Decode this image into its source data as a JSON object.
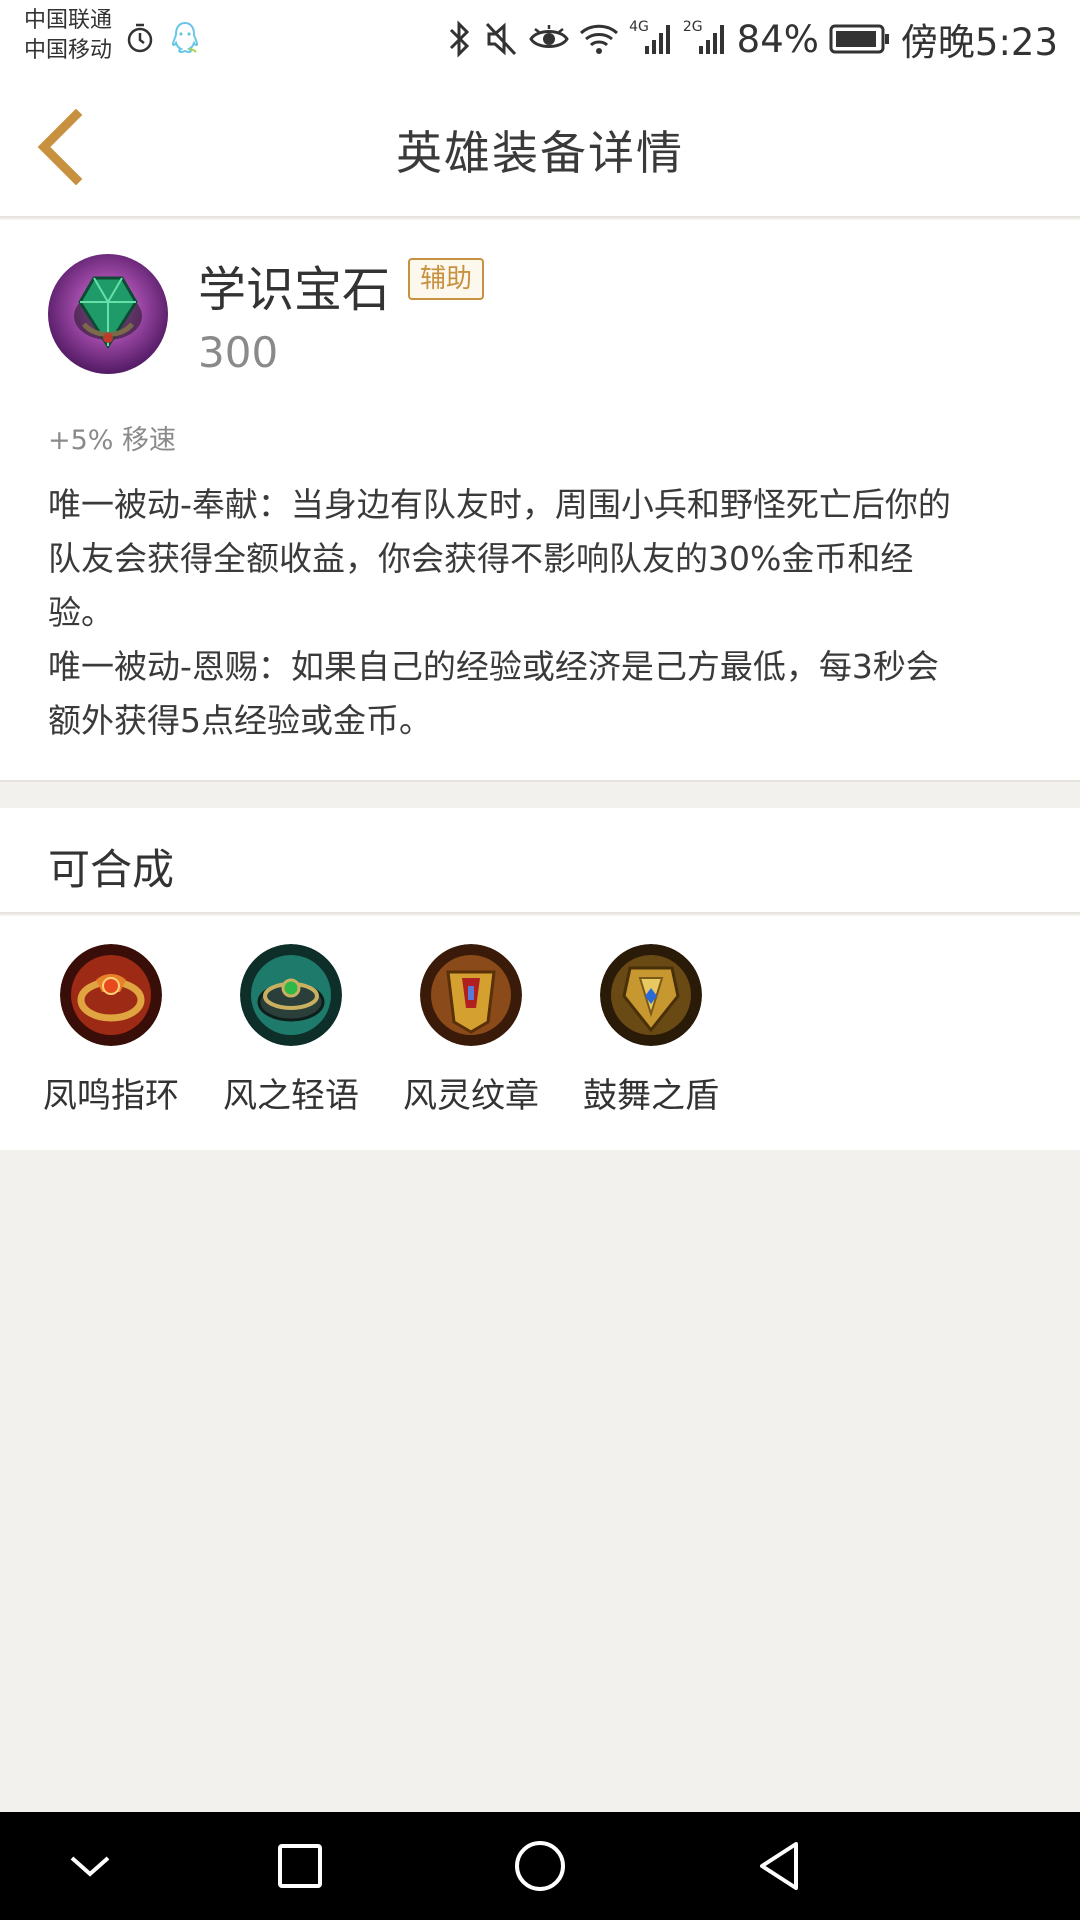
{
  "status_bar": {
    "carrier_1": "中国联通",
    "carrier_2": "中国移动",
    "battery_percent": "84%",
    "time": "傍晚5:23",
    "net_4g": "4G",
    "net_2g": "2G",
    "icons": [
      "alarm-icon",
      "qq-icon",
      "bluetooth-icon",
      "mute-icon",
      "eye-icon",
      "wifi-icon",
      "signal-icon",
      "battery-icon"
    ]
  },
  "header": {
    "title": "英雄装备详情",
    "back_icon": "chevron-left-icon",
    "accent_color": "#c7913f"
  },
  "item": {
    "name": "学识宝石",
    "tag": "辅助",
    "price": "300",
    "stat": "+5% 移速",
    "description_lines": [
      "唯一被动-奉献：当身边有队友时，周围小兵和野怪死亡后你的",
      "队友会获得全额收益，你会获得不影响队友的30%金币和经",
      "验。",
      "唯一被动-恩赐：如果自己的经验或经济是己方最低，每3秒会",
      "额外获得5点经验或金币。"
    ]
  },
  "combine_section": {
    "title": "可合成",
    "items": [
      {
        "label": "凤鸣指环",
        "icon": "phoenix-ring-icon"
      },
      {
        "label": "风之轻语",
        "icon": "wind-whisper-icon"
      },
      {
        "label": "风灵纹章",
        "icon": "wind-spirit-emblem-icon"
      },
      {
        "label": "鼓舞之盾",
        "icon": "inspiring-shield-icon"
      }
    ]
  },
  "nav_bar": {
    "icons": [
      "collapse-down-icon",
      "recent-apps-icon",
      "home-icon",
      "back-triangle-icon"
    ]
  }
}
